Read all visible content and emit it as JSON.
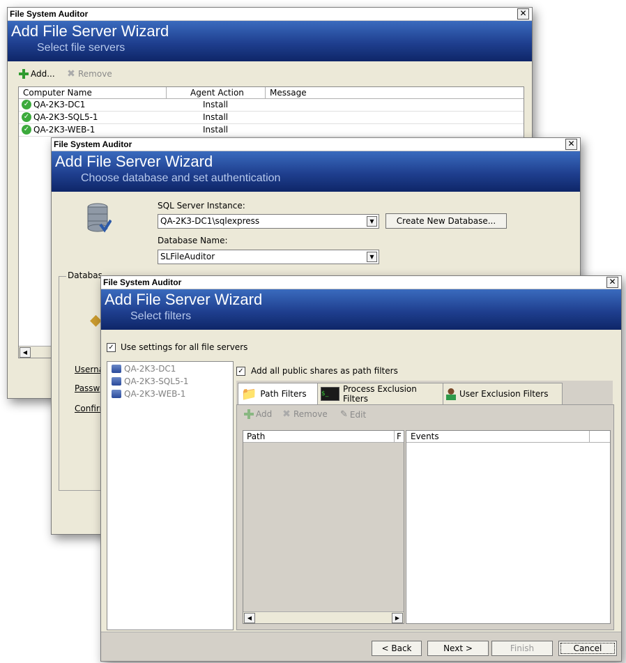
{
  "w1": {
    "title": "File System Auditor",
    "header_title": "Add File Server Wizard",
    "header_sub": "Select file servers",
    "toolbar": {
      "add": "Add...",
      "remove": "Remove"
    },
    "columns": [
      "Computer Name",
      "Agent Action",
      "Message"
    ],
    "rows": [
      {
        "name": "QA-2K3-DC1",
        "action": "Install"
      },
      {
        "name": "QA-2K3-SQL5-1",
        "action": "Install"
      },
      {
        "name": "QA-2K3-WEB-1",
        "action": "Install"
      }
    ]
  },
  "w2": {
    "title": "File System Auditor",
    "header_title": "Add File Server Wizard",
    "header_sub": "Choose database and set authentication",
    "sql_label": "SQL Server Instance:",
    "sql_value": "QA-2K3-DC1\\sqlexpress",
    "create_db": "Create New Database...",
    "db_label": "Database Name:",
    "db_value": "SLFileAuditor",
    "group_label": "Databas",
    "user": "Userna",
    "pass": "Passw",
    "confirm": "Confirr"
  },
  "w3": {
    "title": "File System Auditor",
    "header_title": "Add File Server Wizard",
    "header_sub": "Select filters",
    "use_settings": "Use settings for all file servers",
    "servers": [
      "QA-2K3-DC1",
      "QA-2K3-SQL5-1",
      "QA-2K3-WEB-1"
    ],
    "add_public": "Add all public shares as path filters",
    "tabs": [
      "Path Filters",
      "Process Exclusion Filters",
      "User Exclusion Filters"
    ],
    "toolbar": {
      "add": "Add",
      "remove": "Remove",
      "edit": "Edit"
    },
    "col_path": "Path",
    "col_f": "F",
    "col_events": "Events",
    "buttons": {
      "back": "< Back",
      "next": "Next >",
      "finish": "Finish",
      "cancel": "Cancel"
    }
  }
}
